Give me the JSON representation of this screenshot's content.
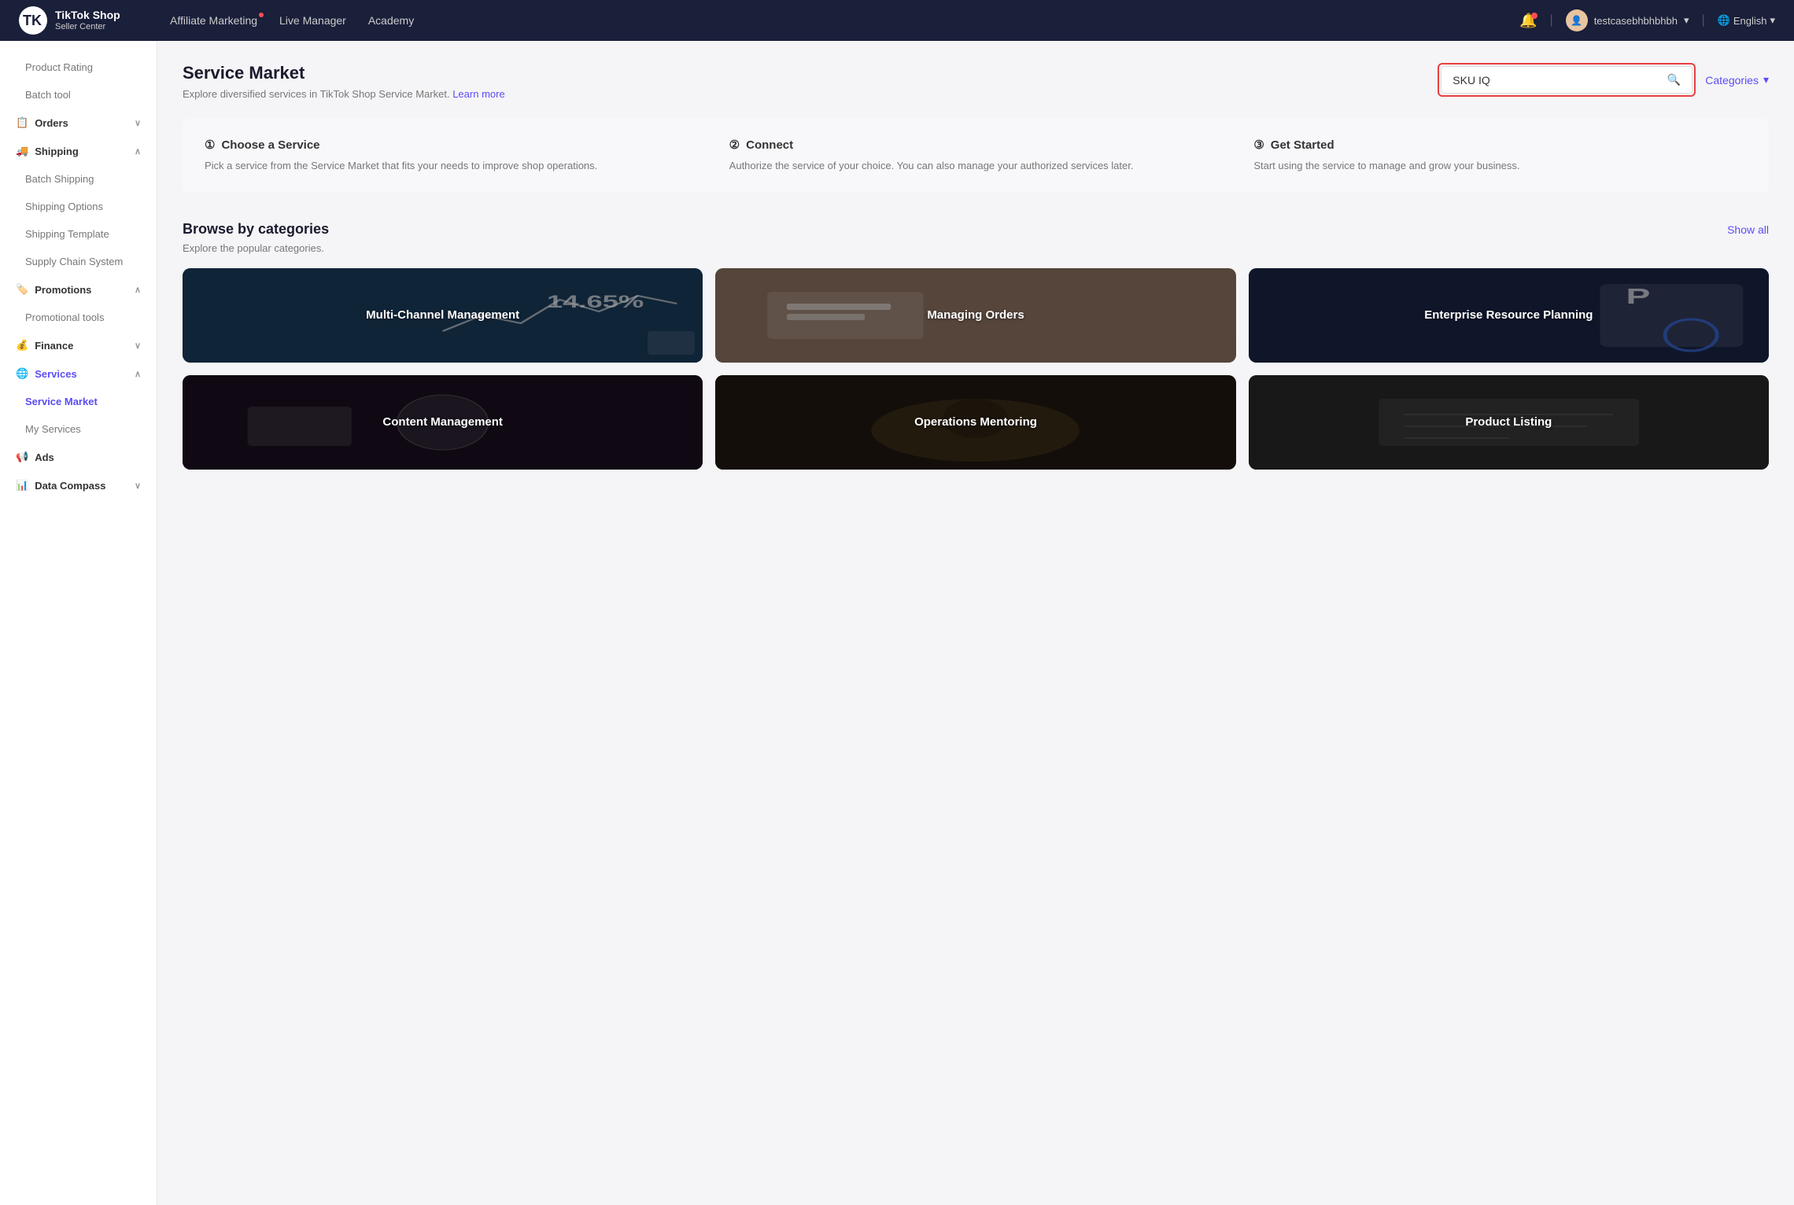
{
  "nav": {
    "logo_shop": "TikTok Shop",
    "logo_seller": "Seller Center",
    "links": [
      {
        "label": "Affiliate Marketing",
        "has_dot": true
      },
      {
        "label": "Live Manager",
        "has_dot": false
      },
      {
        "label": "Academy",
        "has_dot": false
      }
    ],
    "user_name": "testcasebhbhbhbh",
    "lang": "English"
  },
  "sidebar": {
    "items": [
      {
        "label": "Product Rating",
        "type": "plain",
        "indent": true
      },
      {
        "label": "Batch tool",
        "type": "plain",
        "indent": true
      },
      {
        "label": "Orders",
        "type": "section",
        "chevron": "∨"
      },
      {
        "label": "Shipping",
        "type": "section",
        "chevron": "∧"
      },
      {
        "label": "Batch Shipping",
        "type": "sub"
      },
      {
        "label": "Shipping Options",
        "type": "sub"
      },
      {
        "label": "Shipping Template",
        "type": "sub"
      },
      {
        "label": "Supply Chain System",
        "type": "sub"
      },
      {
        "label": "Promotions",
        "type": "section",
        "chevron": "∧"
      },
      {
        "label": "Promotional tools",
        "type": "sub"
      },
      {
        "label": "Finance",
        "type": "section",
        "chevron": "∨"
      },
      {
        "label": "Services",
        "type": "section",
        "chevron": "∧",
        "active": true
      },
      {
        "label": "Service Market",
        "type": "sub",
        "active": true
      },
      {
        "label": "My Services",
        "type": "sub"
      },
      {
        "label": "Ads",
        "type": "section"
      },
      {
        "label": "Data Compass",
        "type": "section",
        "chevron": "∨"
      }
    ]
  },
  "page": {
    "title": "Service Market",
    "subtitle": "Explore diversified services in TikTok Shop Service Market.",
    "learn_more": "Learn more",
    "search_placeholder": "SKU IQ",
    "categories_label": "Categories"
  },
  "steps": [
    {
      "num": "①",
      "title": "Choose a Service",
      "desc": "Pick a service from the Service Market that fits your needs to improve shop operations."
    },
    {
      "num": "②",
      "title": "Connect",
      "desc": "Authorize the service of your choice. You can also manage your authorized services later."
    },
    {
      "num": "③",
      "title": "Get Started",
      "desc": "Start using the service to manage and grow your business."
    }
  ],
  "browse": {
    "title": "Browse by categories",
    "subtitle": "Explore the popular categories.",
    "show_all": "Show all",
    "categories": [
      {
        "label": "Multi-Channel Management",
        "bg_class": "bg-multichannel"
      },
      {
        "label": "Managing Orders",
        "bg_class": "bg-orders"
      },
      {
        "label": "Enterprise Resource Planning",
        "bg_class": "bg-erp"
      },
      {
        "label": "Content Management",
        "bg_class": "bg-content"
      },
      {
        "label": "Operations Mentoring",
        "bg_class": "bg-operations"
      },
      {
        "label": "Product Listing",
        "bg_class": "bg-product"
      }
    ]
  },
  "colors": {
    "accent": "#5b4cf5",
    "danger": "#e84040",
    "nav_bg": "#1a1f3a"
  }
}
